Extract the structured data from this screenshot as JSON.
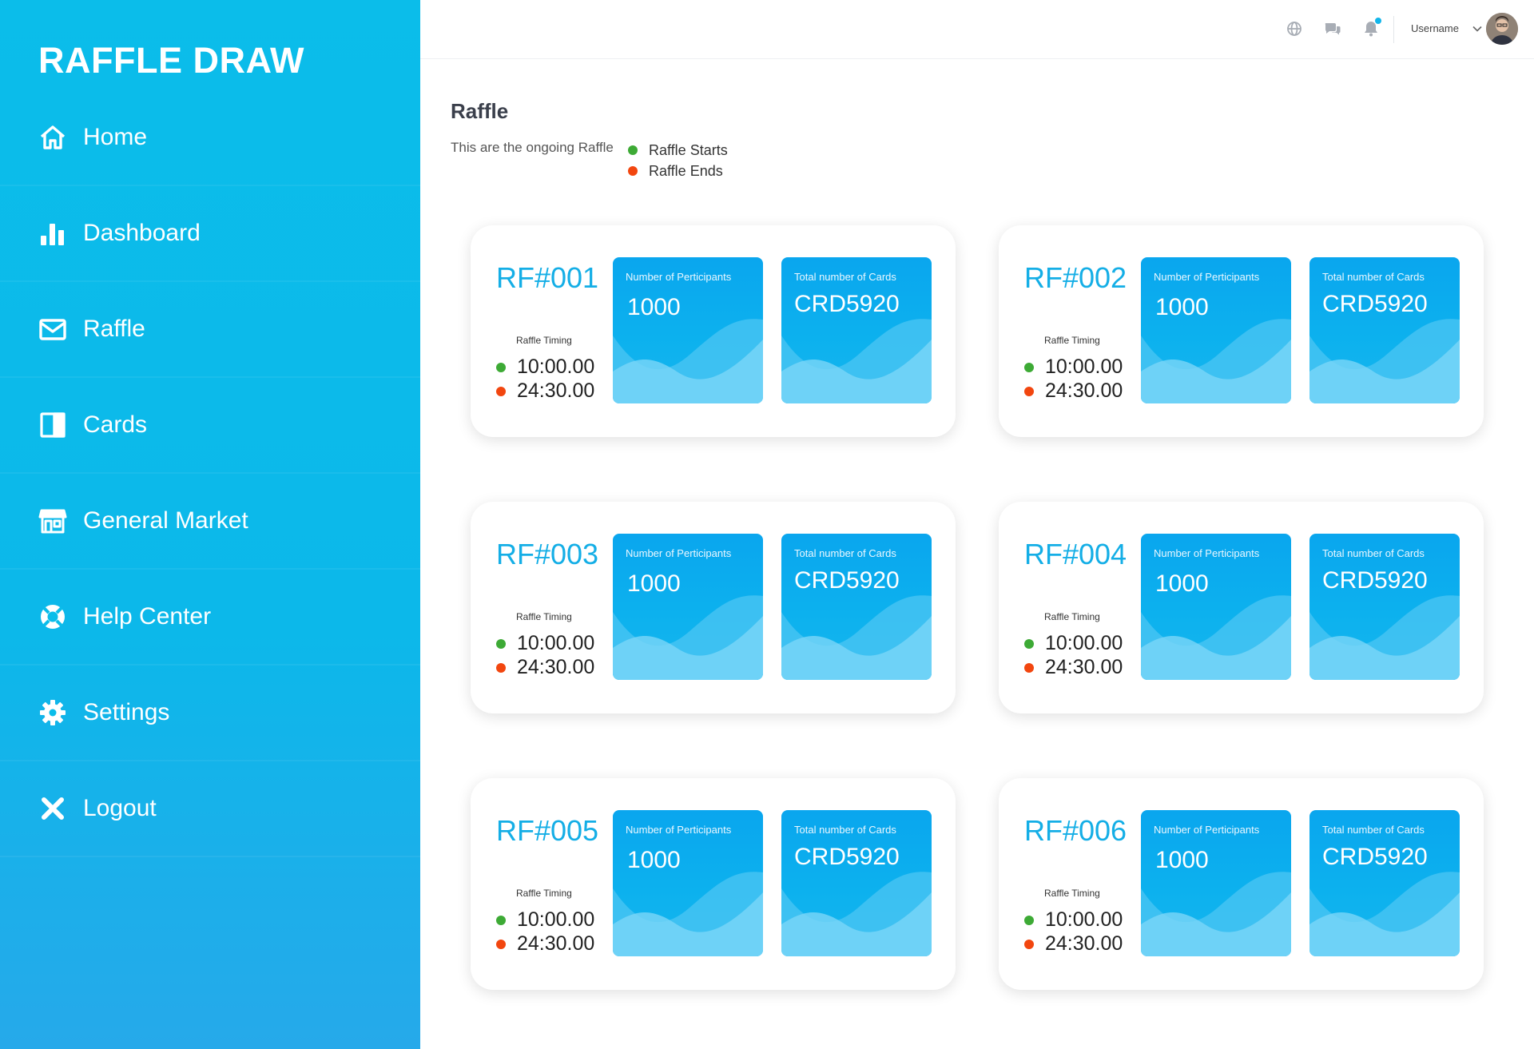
{
  "brand": "RAFFLE DRAW",
  "nav": [
    {
      "label": "Home",
      "icon": "home-icon"
    },
    {
      "label": "Dashboard",
      "icon": "bar-chart-icon"
    },
    {
      "label": "Raffle",
      "icon": "envelope-icon"
    },
    {
      "label": "Cards",
      "icon": "card-icon"
    },
    {
      "label": "General Market",
      "icon": "store-icon"
    },
    {
      "label": "Help Center",
      "icon": "lifebuoy-icon"
    },
    {
      "label": "Settings",
      "icon": "gear-icon"
    },
    {
      "label": "Logout",
      "icon": "close-icon"
    }
  ],
  "topbar": {
    "username": "Username",
    "icons": [
      "globe-icon",
      "chat-icon",
      "bell-icon"
    ]
  },
  "page": {
    "title": "Raffle",
    "subtitle": "This are the ongoing Raffle",
    "legend_start": "Raffle Starts",
    "legend_end": "Raffle Ends"
  },
  "colors": {
    "accent": "#0bbdea",
    "start": "#3daa35",
    "end": "#f2460f"
  },
  "raffles": [
    {
      "id": "RF#001",
      "timing_label": "Raffle Timing",
      "start": "10:00.00",
      "end": "24:30.00",
      "participants_label": "Number of Perticipants",
      "participants": "1000",
      "cards_label": "Total number of Cards",
      "cards": "CRD5920"
    },
    {
      "id": "RF#002",
      "timing_label": "Raffle Timing",
      "start": "10:00.00",
      "end": "24:30.00",
      "participants_label": "Number of Perticipants",
      "participants": "1000",
      "cards_label": "Total number of Cards",
      "cards": "CRD5920"
    },
    {
      "id": "RF#003",
      "timing_label": "Raffle Timing",
      "start": "10:00.00",
      "end": "24:30.00",
      "participants_label": "Number of Perticipants",
      "participants": "1000",
      "cards_label": "Total number of Cards",
      "cards": "CRD5920"
    },
    {
      "id": "RF#004",
      "timing_label": "Raffle Timing",
      "start": "10:00.00",
      "end": "24:30.00",
      "participants_label": "Number of Perticipants",
      "participants": "1000",
      "cards_label": "Total number of Cards",
      "cards": "CRD5920"
    },
    {
      "id": "RF#005",
      "timing_label": "Raffle Timing",
      "start": "10:00.00",
      "end": "24:30.00",
      "participants_label": "Number of Perticipants",
      "participants": "1000",
      "cards_label": "Total number of Cards",
      "cards": "CRD5920"
    },
    {
      "id": "RF#006",
      "timing_label": "Raffle Timing",
      "start": "10:00.00",
      "end": "24:30.00",
      "participants_label": "Number of Perticipants",
      "participants": "1000",
      "cards_label": "Total number of Cards",
      "cards": "CRD5920"
    }
  ]
}
